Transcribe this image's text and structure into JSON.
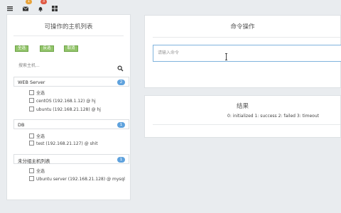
{
  "topbar": {
    "badges": [
      "1",
      "3"
    ]
  },
  "host_panel": {
    "title": "可操作的主机列表",
    "buttons": [
      "全选",
      "反选",
      "取消"
    ],
    "search_placeholder": "搜索主机...",
    "groups": [
      {
        "name": "WEB Server",
        "count": "2",
        "hosts": [
          "全选",
          "centOS (192.168.1.12) @ hj",
          "ubuntu (192.168.21.128) @ hj"
        ]
      },
      {
        "name": "DB",
        "count": "1",
        "hosts": [
          "全选",
          "test (192.168.21.127) @ shit"
        ]
      },
      {
        "name": "未分组主机列表",
        "count": "1",
        "hosts": [
          "全选",
          "Ubuntu server (192.168.21.128) @ mysql"
        ]
      }
    ]
  },
  "command_panel": {
    "title": "命令操作",
    "input_placeholder": "请输入命令"
  },
  "result_panel": {
    "title": "结果",
    "legend": "0: initialized   1: success   2: failed   3: timeout"
  },
  "colors": {
    "button_green": "#92c46a",
    "badge_blue": "#5fa2dd",
    "focus_border": "#7fb3dd"
  }
}
